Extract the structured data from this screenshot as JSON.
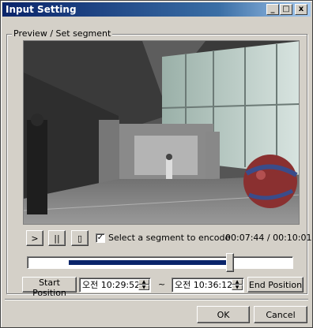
{
  "window": {
    "title": "Input Setting",
    "minimize": "_",
    "maximize": "□",
    "close": "x"
  },
  "preview": {
    "group_label": "Preview / Set segment"
  },
  "controls": {
    "play_label": ">",
    "pause_label": "||",
    "stop_label": "▯",
    "checkbox_checked": true,
    "checkbox_mark": "✓",
    "checkbox_label": "Select a segment to encode",
    "time_readout": "00:07:44 / 00:10:01"
  },
  "slider": {
    "segment_start": 0.155,
    "segment_end": 0.765,
    "thumb_position": 0.765
  },
  "segment": {
    "start_button": "Start Position",
    "start_time": "오전 10:29:52",
    "tilde": "~",
    "end_time": "오전 10:36:12",
    "end_button": "End Position"
  },
  "footer": {
    "ok": "OK",
    "cancel": "Cancel"
  },
  "colors": {
    "titlebar_start": "#0a246a",
    "titlebar_end": "#a6caf0",
    "slider_fill": "#0a246a",
    "dialog_bg": "#d4d0c8"
  }
}
